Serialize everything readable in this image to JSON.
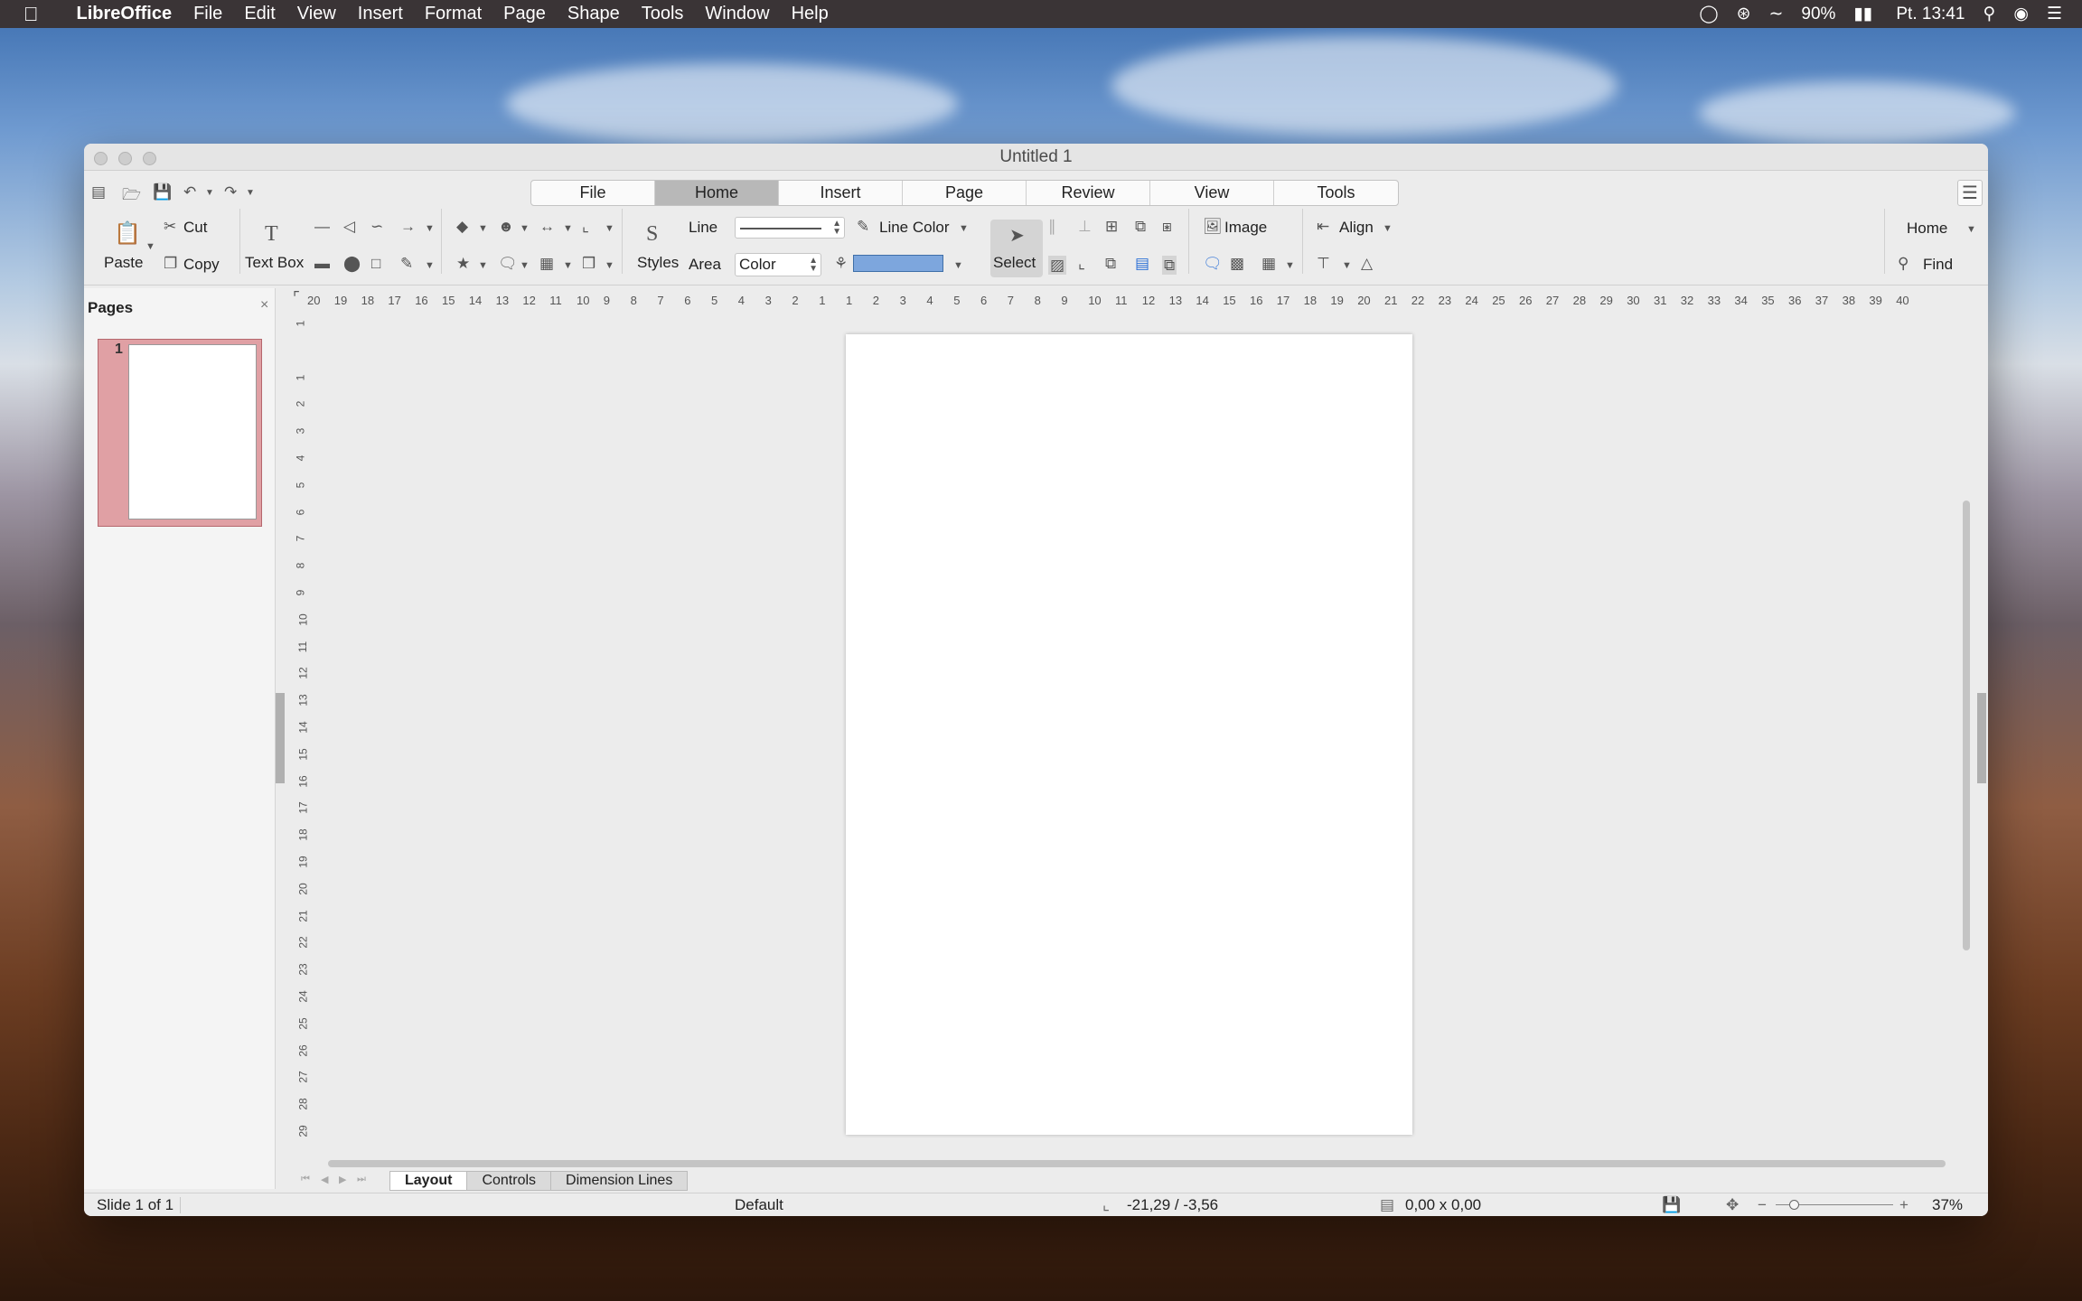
{
  "menubar": {
    "app_name": "LibreOffice",
    "items": [
      "File",
      "Edit",
      "View",
      "Insert",
      "Format",
      "Page",
      "Shape",
      "Tools",
      "Window",
      "Help"
    ],
    "battery": "90%",
    "clock": "Pt. 13:41"
  },
  "window": {
    "title": "Untitled 1"
  },
  "notebookbar": {
    "tabs": [
      "File",
      "Home",
      "Insert",
      "Page",
      "Review",
      "View",
      "Tools"
    ],
    "active": "Home",
    "context_label": "Home"
  },
  "toolbar": {
    "paste": "Paste",
    "cut": "Cut",
    "copy": "Copy",
    "text_box": "Text Box",
    "styles": "Styles",
    "line": "Line",
    "area": "Area",
    "area_value": "Color",
    "line_color": "Line Color",
    "select": "Select",
    "image": "Image",
    "align": "Align",
    "find": "Find",
    "colors": {
      "fill": "#7da6dd"
    }
  },
  "pages_panel": {
    "title": "Pages",
    "page_number": "1"
  },
  "rulers": {
    "h_ticks": [
      "20",
      "19",
      "18",
      "17",
      "16",
      "15",
      "14",
      "13",
      "12",
      "11",
      "10",
      "9",
      "8",
      "7",
      "6",
      "5",
      "4",
      "3",
      "2",
      "1",
      "1",
      "2",
      "3",
      "4",
      "5",
      "6",
      "7",
      "8",
      "9",
      "10",
      "11",
      "12",
      "13",
      "14",
      "15",
      "16",
      "17",
      "18",
      "19",
      "20",
      "21",
      "22",
      "23",
      "24",
      "25",
      "26",
      "27",
      "28",
      "29",
      "30",
      "31",
      "32",
      "33",
      "34",
      "35",
      "36",
      "37",
      "38",
      "39",
      "40"
    ],
    "v_ticks": [
      "1",
      "",
      "1",
      "2",
      "3",
      "4",
      "5",
      "6",
      "7",
      "8",
      "9",
      "10",
      "11",
      "12",
      "13",
      "14",
      "15",
      "16",
      "17",
      "18",
      "19",
      "20",
      "21",
      "22",
      "23",
      "24",
      "25",
      "26",
      "27",
      "28",
      "29"
    ]
  },
  "sheet_tabs": [
    "Layout",
    "Controls",
    "Dimension Lines"
  ],
  "status": {
    "slide": "Slide 1 of 1",
    "master": "Default",
    "position": "-21,29 / -3,56",
    "size": "0,00 x 0,00",
    "zoom": "37%"
  }
}
